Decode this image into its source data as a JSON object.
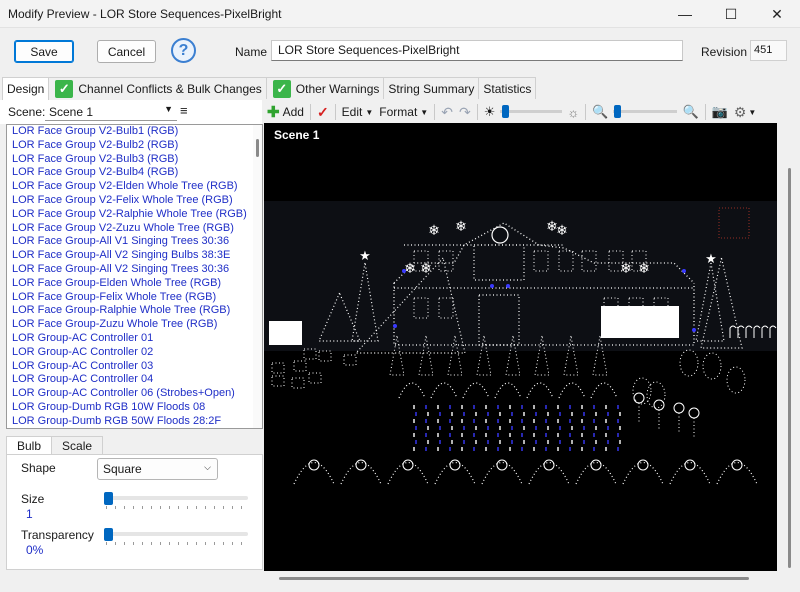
{
  "window": {
    "title": "Modify Preview - LOR Store Sequences-PixelBright",
    "minimize": "—",
    "maximize": "☐",
    "close": "✕"
  },
  "top": {
    "save_label": "Save",
    "cancel_label": "Cancel",
    "help_glyph": "?",
    "name_label": "Name",
    "name_value": "LOR Store Sequences-PixelBright",
    "revision_label": "Revision",
    "revision_value": "451"
  },
  "tabs": [
    {
      "label": "Design",
      "checked": false,
      "active": true
    },
    {
      "label": "Channel Conflicts & Bulk Changes",
      "checked": true,
      "active": false
    },
    {
      "label": "Other Warnings",
      "checked": true,
      "active": false
    },
    {
      "label": "String Summary",
      "checked": false,
      "active": false
    },
    {
      "label": "Statistics",
      "checked": false,
      "active": false
    }
  ],
  "check_glyph": "✓",
  "scene": {
    "label": "Scene:",
    "value": "Scene 1",
    "menu_glyph": "≡"
  },
  "props_list": [
    "LOR Face Group V2-Bulb1 (RGB)",
    "LOR Face Group V2-Bulb2 (RGB)",
    "LOR Face Group V2-Bulb3 (RGB)",
    "LOR Face Group V2-Bulb4 (RGB)",
    "LOR Face Group V2-Elden Whole Tree (RGB)",
    "LOR Face Group V2-Felix Whole Tree (RGB)",
    "LOR Face Group V2-Ralphie Whole Tree (RGB)",
    "LOR Face Group V2-Zuzu Whole Tree (RGB)",
    "LOR Face Group-All V1 Singing Trees 30:36",
    "LOR Face Group-All V2 Singing Bulbs 38:3E",
    "LOR Face Group-All V2 Singing Trees 30:36",
    "LOR Face Group-Elden Whole Tree (RGB)",
    "LOR Face Group-Felix Whole Tree (RGB)",
    "LOR Face Group-Ralphie Whole Tree (RGB)",
    "LOR Face Group-Zuzu Whole Tree (RGB)",
    "LOR Group-AC Controller 01",
    "LOR Group-AC Controller 02",
    "LOR Group-AC Controller 03",
    "LOR Group-AC Controller 04",
    "LOR Group-AC Controller 06 (Strobes+Open)",
    "LOR Group-Dumb RGB 10W Floods 08",
    "LOR Group-Dumb RGB 50W Floods 28:2F"
  ],
  "subtabs": [
    {
      "label": "Bulb",
      "active": true
    },
    {
      "label": "Scale",
      "active": false
    }
  ],
  "bulb": {
    "shape_label": "Shape",
    "shape_value": "Square",
    "size_label": "Size",
    "size_value": "1",
    "transparency_label": "Transparency",
    "transparency_value": "0%",
    "size_level": 0,
    "transparency_level": 0
  },
  "toolbar": {
    "add_label": "Add",
    "edit_label": "Edit",
    "format_label": "Format",
    "brightness_level": 0.03,
    "zoom_level": 0.02,
    "icons": [
      "add-icon",
      "check-icon",
      "undo-icon",
      "redo-icon",
      "brightness-low-icon",
      "brightness-high-icon",
      "zoom-out-icon",
      "zoom-in-icon",
      "camera-icon",
      "gear-icon"
    ]
  },
  "preview": {
    "title": "Scene 1",
    "background": "#000000",
    "light_color": "#ffffff",
    "accent_light_color": "#3a3aff"
  },
  "colors": {
    "accent": "#0067c0",
    "list_text": "#1f2ec7",
    "check_green": "#3bb54a"
  }
}
